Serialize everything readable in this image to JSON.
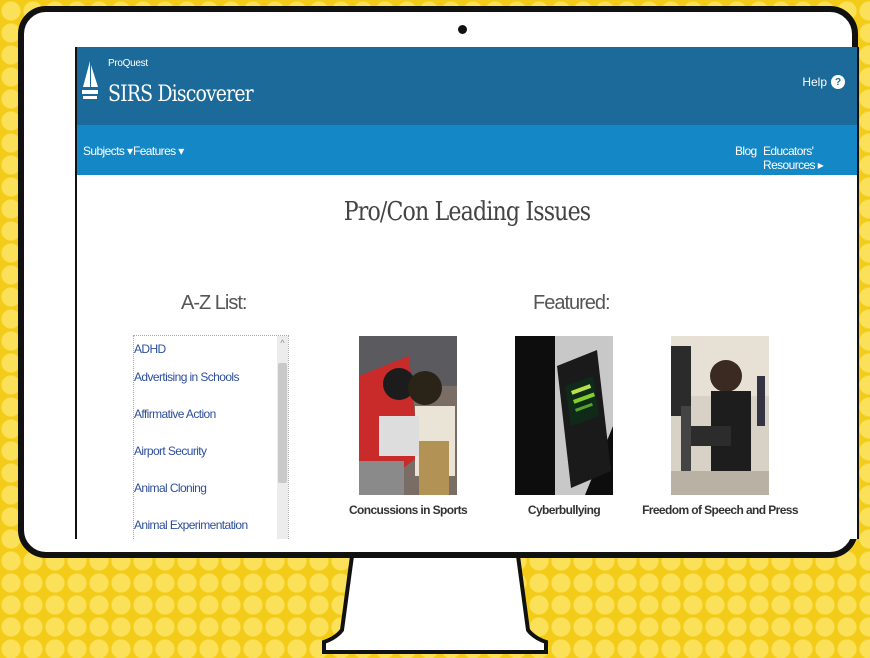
{
  "header": {
    "brand_small": "ProQuest",
    "brand_big": "SIRS Discoverer",
    "help_label": "Help",
    "help_icon": "?"
  },
  "nav": {
    "subjects_label": "Subjects ▾",
    "features_label": "Features ▾",
    "blog_label": "Blog",
    "educators_label": "Educators' Resources ▸"
  },
  "main": {
    "title": "Pro/Con Leading Issues",
    "az_heading": "A-Z List:",
    "featured_heading": "Featured:",
    "az_items": [
      {
        "label": "ADHD"
      },
      {
        "label": "Advertising in Schools"
      },
      {
        "label": "Affirmative Action"
      },
      {
        "label": "Airport Security"
      },
      {
        "label": "Animal Cloning"
      },
      {
        "label": "Animal Experimentation"
      }
    ],
    "featured": [
      {
        "label": "Concussions in Sports",
        "icon": "football-photo"
      },
      {
        "label": "Cyberbullying",
        "icon": "phone-photo"
      },
      {
        "label": "Freedom of Speech and Press",
        "icon": "camera-photo"
      }
    ]
  },
  "colors": {
    "header_bg": "#1b6a9a",
    "nav_bg": "#1488c6",
    "link": "#2d4f9c",
    "background": "#f3cc1a"
  }
}
